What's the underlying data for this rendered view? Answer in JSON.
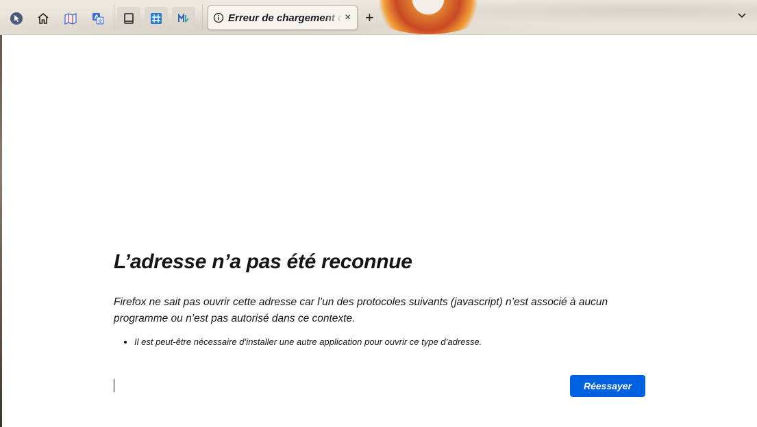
{
  "tab": {
    "title": "Erreur de chargement de la page",
    "close_label": "×",
    "new_tab_label": "+"
  },
  "toolbar_icons": [
    "cursor-icon",
    "home-icon",
    "map-icon",
    "translate-icon",
    "reader-icon",
    "grid-icon",
    "markdown-icon"
  ],
  "error_page": {
    "title": "L’adresse n’a pas été reconnue",
    "description": "Firefox ne sait pas ouvrir cette adresse car l’un des protocoles suivants (javascript) n’est associé à aucun programme ou n’est pas autorisé dans ce contexte.",
    "bullets": [
      "Il est peut-être nécessaire d’installer une autre application pour ouvrir ce type d’adresse."
    ],
    "retry_label": "Réessayer"
  },
  "colors": {
    "accent": "#0061e0",
    "text": "#15141a"
  }
}
